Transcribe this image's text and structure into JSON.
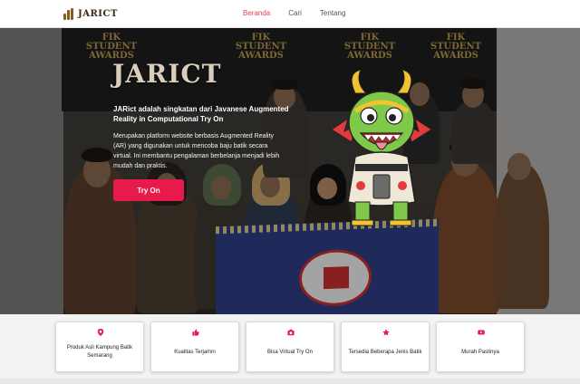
{
  "nav": {
    "logo_text": "JARICT",
    "links": [
      {
        "label": "Beranda",
        "active": true
      },
      {
        "label": "Cari",
        "active": false
      },
      {
        "label": "Tentang",
        "active": false
      }
    ]
  },
  "hero": {
    "title": "JARICT",
    "headline": "JARict adalah singkatan dari Javanese Augmented Reality in Computational Try On",
    "description": [
      "Merupakan platform website berbasis Augmented Reality (AR) yang digunakan untuk mencoba baju batik secara virtual.",
      "Ini membantu pengalaman berbelanja menjadi lebih mudah dan praktis."
    ],
    "cta_label": "Try On",
    "background_banner_text": "FIK STUDENT AWARDS"
  },
  "features": [
    {
      "label": "Produk Asli Kampung Batik Semarang",
      "icon": "map-pin-icon"
    },
    {
      "label": "Kualitas Terjamin",
      "icon": "thumbs-up-icon"
    },
    {
      "label": "Bisa Virtual Try On",
      "icon": "camera-icon"
    },
    {
      "label": "Tersedia Beberapa Jenis Batik",
      "icon": "star-icon"
    },
    {
      "label": "Murah Pastinya",
      "icon": "youtube-icon"
    }
  ],
  "colors": {
    "accent": "#e8194b",
    "nav_active": "#e63b55",
    "icon": "#e8194b"
  }
}
